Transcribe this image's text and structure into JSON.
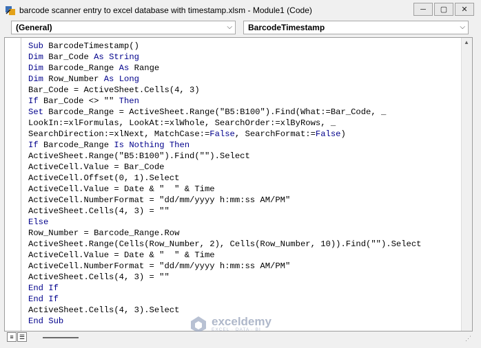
{
  "window": {
    "title": "barcode scanner entry to excel database with timestamp.xlsm - Module1 (Code)",
    "controls": {
      "minimize": "─",
      "maximize": "▢",
      "close": "✕"
    }
  },
  "object_dropdown": {
    "value": "(General)"
  },
  "procedure_dropdown": {
    "value": "BarcodeTimestamp"
  },
  "code_lines": [
    [
      {
        "t": "Sub",
        "k": true
      },
      {
        "t": " BarcodeTimestamp()"
      }
    ],
    [
      {
        "t": "Dim",
        "k": true
      },
      {
        "t": " Bar_Code "
      },
      {
        "t": "As",
        "k": true
      },
      {
        "t": " "
      },
      {
        "t": "String",
        "k": true
      }
    ],
    [
      {
        "t": "Dim",
        "k": true
      },
      {
        "t": " Barcode_Range "
      },
      {
        "t": "As",
        "k": true
      },
      {
        "t": " Range"
      }
    ],
    [
      {
        "t": "Dim",
        "k": true
      },
      {
        "t": " Row_Number "
      },
      {
        "t": "As",
        "k": true
      },
      {
        "t": " "
      },
      {
        "t": "Long",
        "k": true
      }
    ],
    [
      {
        "t": "Bar_Code = ActiveSheet.Cells(4, 3)"
      }
    ],
    [
      {
        "t": "If",
        "k": true
      },
      {
        "t": " Bar_Code <> \"\" "
      },
      {
        "t": "Then",
        "k": true
      }
    ],
    [
      {
        "t": "Set",
        "k": true
      },
      {
        "t": " Barcode_Range = ActiveSheet.Range(\"B5:B100\").Find(What:=Bar_Code, _"
      }
    ],
    [
      {
        "t": "LookIn:=xlFormulas, LookAt:=xlWhole, SearchOrder:=xlByRows, _"
      }
    ],
    [
      {
        "t": "SearchDirection:=xlNext, MatchCase:="
      },
      {
        "t": "False",
        "k": true
      },
      {
        "t": ", SearchFormat:="
      },
      {
        "t": "False",
        "k": true
      },
      {
        "t": ")"
      }
    ],
    [
      {
        "t": "If",
        "k": true
      },
      {
        "t": " Barcode_Range "
      },
      {
        "t": "Is",
        "k": true
      },
      {
        "t": " "
      },
      {
        "t": "Nothing",
        "k": true
      },
      {
        "t": " "
      },
      {
        "t": "Then",
        "k": true
      }
    ],
    [
      {
        "t": "ActiveSheet.Range(\"B5:B100\").Find(\"\").Select"
      }
    ],
    [
      {
        "t": "ActiveCell.Value = Bar_Code"
      }
    ],
    [
      {
        "t": "ActiveCell.Offset(0, 1).Select"
      }
    ],
    [
      {
        "t": "ActiveCell.Value = Date & \"  \" & Time"
      }
    ],
    [
      {
        "t": "ActiveCell.NumberFormat = \"dd/mm/yyyy h:mm:ss AM/PM\""
      }
    ],
    [
      {
        "t": "ActiveSheet.Cells(4, 3) = \"\""
      }
    ],
    [
      {
        "t": "Else",
        "k": true
      }
    ],
    [
      {
        "t": "Row_Number = Barcode_Range.Row"
      }
    ],
    [
      {
        "t": "ActiveSheet.Range(Cells(Row_Number, 2), Cells(Row_Number, 10)).Find(\"\").Select"
      }
    ],
    [
      {
        "t": "ActiveCell.Value = Date & \"  \" & Time"
      }
    ],
    [
      {
        "t": "ActiveCell.NumberFormat = \"dd/mm/yyyy h:mm:ss AM/PM\""
      }
    ],
    [
      {
        "t": "ActiveSheet.Cells(4, 3) = \"\""
      }
    ],
    [
      {
        "t": "End If",
        "k": true
      }
    ],
    [
      {
        "t": "End If",
        "k": true
      }
    ],
    [
      {
        "t": "ActiveSheet.Cells(4, 3).Select"
      }
    ],
    [
      {
        "t": "End Sub",
        "k": true
      }
    ]
  ],
  "colors": {
    "keyword": "#00008b",
    "text": "#000000"
  },
  "watermark": {
    "title": "exceldemy",
    "subtitle": "EXCEL · DATA · BI"
  },
  "icons": [
    "vba-app-icon",
    "minimize-icon",
    "maximize-icon",
    "close-icon",
    "chevron-down-icon",
    "procedure-view-icon",
    "full-module-view-icon",
    "resize-grip-icon"
  ]
}
